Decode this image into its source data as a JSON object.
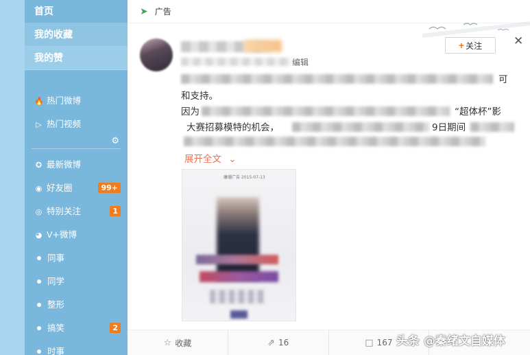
{
  "sidebar": {
    "top_items": [
      {
        "label": "首页"
      },
      {
        "label": "我的收藏"
      },
      {
        "label": "我的赞"
      }
    ],
    "items": [
      {
        "label": "热门微博",
        "icon": "flame-icon"
      },
      {
        "label": "热门视频",
        "icon": "video-icon"
      }
    ],
    "groups": [
      {
        "label": "最新微博",
        "icon": "star-icon",
        "badge": ""
      },
      {
        "label": "好友圈",
        "icon": "friends-icon",
        "badge": "99+"
      },
      {
        "label": "特别关注",
        "icon": "target-icon",
        "badge": "1"
      },
      {
        "label": "V+微博",
        "icon": "vplus-icon",
        "badge": ""
      },
      {
        "label": "同事",
        "icon": "dot-icon",
        "badge": ""
      },
      {
        "label": "同学",
        "icon": "dot-icon",
        "badge": ""
      },
      {
        "label": "整形",
        "icon": "dot-icon",
        "badge": ""
      },
      {
        "label": "搞笑",
        "icon": "dot-icon",
        "badge": "2"
      },
      {
        "label": "时事",
        "icon": "dot-icon",
        "badge": ""
      }
    ]
  },
  "post": {
    "ad_label": "广告",
    "meta_suffix": "编辑",
    "follow_label": "关注",
    "line1_tail": "可",
    "line2": "和支持。",
    "line3_head": "因为",
    "line3_tail": "“超体杯”影",
    "line4_head": "大赛招募模特的机会，",
    "line4_tail": "9日期间",
    "expand_label": "展开全文",
    "image_caption": "康珊广告 2015-07-13"
  },
  "actions": {
    "favorite_label": "收藏",
    "repost_count": "16",
    "comment_count": "167"
  },
  "watermark": "头条 @秦绪文自媒体",
  "colors": {
    "sidebar_bg": "#7ab7dc",
    "badge": "#f07c1e",
    "link": "#eb7350"
  }
}
